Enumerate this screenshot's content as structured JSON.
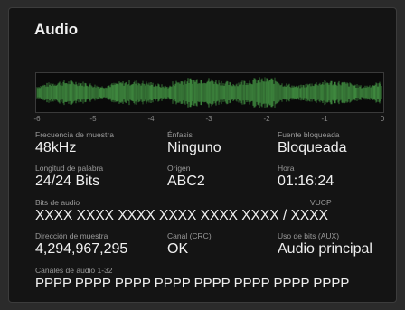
{
  "panel": {
    "title": "Audio"
  },
  "meter": {
    "scale": [
      "-6",
      "-5",
      "-4",
      "-3",
      "-2",
      "-1",
      "0"
    ],
    "waveform_color": "#3f8a3f"
  },
  "fields": {
    "sample_rate": {
      "label": "Frecuencia de muestra",
      "value": "48kHz"
    },
    "emphasis": {
      "label": "Énfasis",
      "value": "Ninguno"
    },
    "locked_source": {
      "label": "Fuente bloqueada",
      "value": "Bloqueada"
    },
    "word_length": {
      "label": "Longitud de palabra",
      "value": "24/24 Bits"
    },
    "origin": {
      "label": "Origen",
      "value": "ABC2"
    },
    "time": {
      "label": "Hora",
      "value": "01:16:24"
    },
    "audio_bits": {
      "label": "Bits de audio",
      "label2": "VUCP",
      "value": "XXXX XXXX XXXX XXXX XXXX XXXX / XXXX"
    },
    "sample_address": {
      "label": "Dirección de muestra",
      "value": "4,294,967,295"
    },
    "crc_channel": {
      "label": "Canal (CRC)",
      "value": "OK"
    },
    "aux_bits": {
      "label": "Uso de bits (AUX)",
      "value": "Audio principal"
    },
    "channels": {
      "label": "Canales de audio 1-32",
      "value": "PPPP PPPP PPPP PPPP PPPP PPPP PPPP PPPP"
    }
  }
}
